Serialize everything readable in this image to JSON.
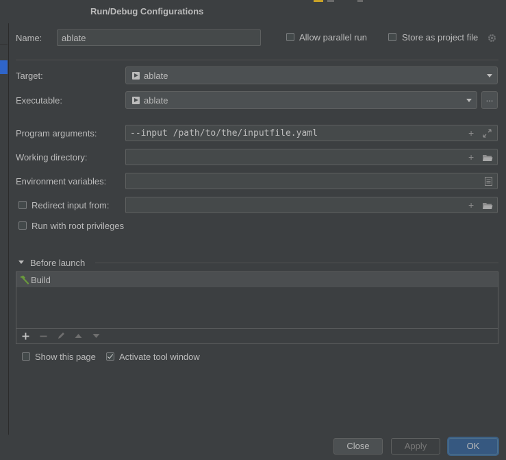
{
  "window": {
    "title": "Run/Debug Configurations"
  },
  "name": {
    "label": "Name:",
    "value": "ablate"
  },
  "options": {
    "allow_parallel_run": {
      "label": "Allow parallel run",
      "checked": false
    },
    "store_as_project_file": {
      "label": "Store as project file",
      "checked": false
    }
  },
  "target": {
    "label": "Target:",
    "value": "ablate"
  },
  "executable": {
    "label": "Executable:",
    "value": "ablate",
    "browse": "..."
  },
  "program_arguments": {
    "label": "Program arguments:",
    "value": "--input /path/to/the/inputfile.yaml"
  },
  "working_directory": {
    "label": "Working directory:",
    "value": ""
  },
  "environment_variables": {
    "label": "Environment variables:",
    "value": ""
  },
  "redirect_input": {
    "label": "Redirect input from:",
    "checked": false,
    "value": ""
  },
  "root_privileges": {
    "label": "Run with root privileges",
    "checked": false
  },
  "before_launch": {
    "label": "Before launch",
    "items": [
      "Build"
    ]
  },
  "show_this_page": {
    "label": "Show this page",
    "checked": false
  },
  "activate_tool_window": {
    "label": "Activate tool window",
    "checked": true
  },
  "buttons": {
    "close": "Close",
    "apply": "Apply",
    "ok": "OK"
  },
  "colors": {
    "accent": "#365880",
    "selection": "#2f65ca",
    "build_icon": "#6a9a3c"
  }
}
